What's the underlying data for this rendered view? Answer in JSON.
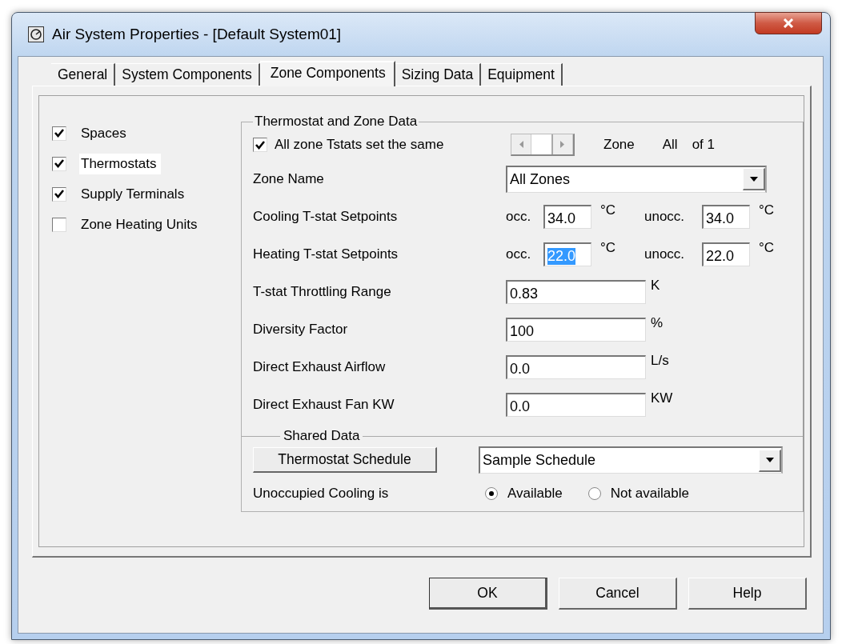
{
  "window": {
    "title": "Air System Properties - [Default System01]"
  },
  "tabs": [
    {
      "label": "General",
      "selected": false
    },
    {
      "label": "System Components",
      "selected": false
    },
    {
      "label": "Zone Components",
      "selected": true
    },
    {
      "label": "Sizing Data",
      "selected": false
    },
    {
      "label": "Equipment",
      "selected": false
    }
  ],
  "components": [
    {
      "label": "Spaces",
      "checked": true,
      "selected": false
    },
    {
      "label": "Thermostats",
      "checked": true,
      "selected": true
    },
    {
      "label": "Supply Terminals",
      "checked": true,
      "selected": false
    },
    {
      "label": "Zone Heating Units",
      "checked": false,
      "selected": false
    }
  ],
  "zone_data": {
    "title": "Thermostat and Zone Data",
    "all_same": {
      "label": "All zone Tstats set the same",
      "checked": true
    },
    "zone_label": "Zone",
    "zone_value": "All",
    "zone_count": "of 1",
    "rows": [
      {
        "kind": "dropdown",
        "label": "Zone Name",
        "value": "All Zones"
      },
      {
        "kind": "setpoints",
        "label": "Cooling T-stat Setpoints",
        "occ_label": "occ.",
        "occ_value": "34.0",
        "occ_selected": false,
        "occ_unit": "°C",
        "unocc_label": "unocc.",
        "unocc_value": "34.0",
        "unocc_unit": "°C"
      },
      {
        "kind": "setpoints",
        "label": "Heating T-stat Setpoints",
        "occ_label": "occ.",
        "occ_value": "22.0",
        "occ_selected": true,
        "occ_unit": "°C",
        "unocc_label": "unocc.",
        "unocc_value": "22.0",
        "unocc_unit": "°C"
      },
      {
        "kind": "field",
        "label": "T-stat Throttling Range",
        "value": "0.83",
        "unit": "K"
      },
      {
        "kind": "field",
        "label": "Diversity Factor",
        "value": "100",
        "unit": "%"
      },
      {
        "kind": "field",
        "label": "Direct Exhaust Airflow",
        "value": "0.0",
        "unit": "L/s"
      },
      {
        "kind": "field",
        "label": "Direct Exhaust Fan KW",
        "value": "0.0",
        "unit": "KW"
      }
    ]
  },
  "shared_data": {
    "title": "Shared Data",
    "schedule_button": "Thermostat Schedule",
    "schedule": "Sample Schedule",
    "unoccupied_label": "Unoccupied Cooling is",
    "options": [
      {
        "label": "Available",
        "selected": true
      },
      {
        "label": "Not available",
        "selected": false
      }
    ]
  },
  "buttons": [
    {
      "label": "OK",
      "default": true
    },
    {
      "label": "Cancel",
      "default": false
    },
    {
      "label": "Help",
      "default": false
    }
  ]
}
